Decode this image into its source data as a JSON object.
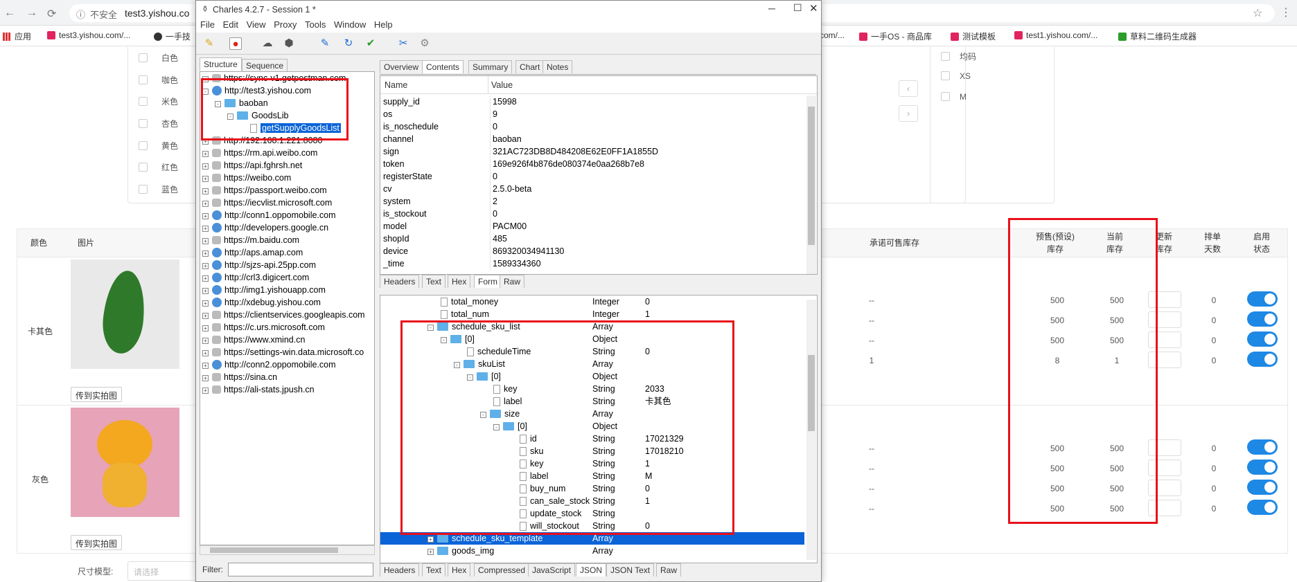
{
  "browser": {
    "insecure_label": "不安全",
    "url": "test3.yishou.co",
    "bookmarks_left": [
      {
        "label": "应用"
      },
      {
        "label": "test3.yishou.com/..."
      },
      {
        "label": "一手技"
      }
    ],
    "bookmarks_right": [
      {
        "label": "com/..."
      },
      {
        "label": "一手OS - 商品库"
      },
      {
        "label": "测试模板"
      },
      {
        "label": "test1.yishou.com/..."
      },
      {
        "label": "草料二维码生成器"
      }
    ]
  },
  "page": {
    "colors": [
      "白色",
      "咖色",
      "米色",
      "杏色",
      "黄色",
      "红色",
      "蓝色"
    ],
    "sizes": [
      "均码",
      "XS",
      "M"
    ],
    "table_headers": {
      "color": "颜色",
      "image": "图片",
      "promised": "承诺可售库存",
      "presale": "预售(预设)\n库存",
      "current": "当前\n库存",
      "update": "更新\n库存",
      "queue": "排单\n天数",
      "status": "启用\n状态"
    },
    "row_labels": [
      "卡其色",
      "灰色"
    ],
    "upload_btn": "传到实拍图",
    "size_model_label": "尺寸模型:",
    "size_model_placeholder": "请选择",
    "rows": [
      {
        "promised": "--",
        "presale": "500",
        "current": "500",
        "queue": "0"
      },
      {
        "promised": "--",
        "presale": "500",
        "current": "500",
        "queue": "0"
      },
      {
        "promised": "--",
        "presale": "500",
        "current": "500",
        "queue": "0"
      },
      {
        "promised": "1",
        "presale": "8",
        "current": "1",
        "queue": "0"
      },
      {
        "promised": "--",
        "presale": "500",
        "current": "500",
        "queue": "0"
      },
      {
        "promised": "--",
        "presale": "500",
        "current": "500",
        "queue": "0"
      },
      {
        "promised": "--",
        "presale": "500",
        "current": "500",
        "queue": "0"
      },
      {
        "promised": "--",
        "presale": "500",
        "current": "500",
        "queue": "0"
      }
    ]
  },
  "charles": {
    "title": "Charles 4.2.7 - Session 1 *",
    "menu": [
      "File",
      "Edit",
      "View",
      "Proxy",
      "Tools",
      "Window",
      "Help"
    ],
    "left_tabs": [
      "Structure",
      "Sequence"
    ],
    "top_tabs": [
      "Overview",
      "Contents",
      "Summary",
      "Chart",
      "Notes"
    ],
    "kv_headers": {
      "name": "Name",
      "value": "Value"
    },
    "kv": [
      {
        "k": "supply_id",
        "v": "15998"
      },
      {
        "k": "os",
        "v": "9"
      },
      {
        "k": "is_noschedule",
        "v": "0"
      },
      {
        "k": "channel",
        "v": "baoban"
      },
      {
        "k": "sign",
        "v": "321AC723DB8D484208E62E0FF1A1855D"
      },
      {
        "k": "token",
        "v": "169e926f4b876de080374e0aa268b7e8"
      },
      {
        "k": "registerState",
        "v": "0"
      },
      {
        "k": "cv",
        "v": "2.5.0-beta"
      },
      {
        "k": "system",
        "v": "2"
      },
      {
        "k": "is_stockout",
        "v": "0"
      },
      {
        "k": "model",
        "v": "PACM00"
      },
      {
        "k": "shopId",
        "v": "485"
      },
      {
        "k": "device",
        "v": "869320034941130"
      },
      {
        "k": "_time",
        "v": "1589334360"
      }
    ],
    "req_tabs": [
      "Headers",
      "Text",
      "Hex",
      "Form",
      "Raw"
    ],
    "resp_tabs": [
      "Headers",
      "Text",
      "Hex",
      "Compressed",
      "JavaScript",
      "JSON",
      "JSON Text",
      "Raw"
    ],
    "filter_label": "Filter:",
    "tree": [
      {
        "label": "https://sync-v1.getpostman.com",
        "icon": "lock",
        "indent": 0,
        "exp": "+"
      },
      {
        "label": "http://test3.yishou.com",
        "icon": "globe",
        "indent": 0,
        "exp": "-"
      },
      {
        "label": "baoban",
        "icon": "folder",
        "indent": 1,
        "exp": "-"
      },
      {
        "label": "GoodsLib",
        "icon": "folder",
        "indent": 2,
        "exp": "-"
      },
      {
        "label": "getSupplyGoodsList",
        "icon": "file",
        "indent": 3,
        "exp": "",
        "sel": true
      },
      {
        "label": "http://192.168.1.221:8080",
        "icon": "lock",
        "indent": 0,
        "exp": "+"
      },
      {
        "label": "https://rm.api.weibo.com",
        "icon": "lock",
        "indent": 0,
        "exp": "+"
      },
      {
        "label": "https://api.fghrsh.net",
        "icon": "lock",
        "indent": 0,
        "exp": "+"
      },
      {
        "label": "https://weibo.com",
        "icon": "lock",
        "indent": 0,
        "exp": "+"
      },
      {
        "label": "https://passport.weibo.com",
        "icon": "lock",
        "indent": 0,
        "exp": "+"
      },
      {
        "label": "https://iecvlist.microsoft.com",
        "icon": "lock",
        "indent": 0,
        "exp": "+"
      },
      {
        "label": "http://conn1.oppomobile.com",
        "icon": "globe",
        "indent": 0,
        "exp": "+"
      },
      {
        "label": "http://developers.google.cn",
        "icon": "globe",
        "indent": 0,
        "exp": "+"
      },
      {
        "label": "https://m.baidu.com",
        "icon": "lock",
        "indent": 0,
        "exp": "+"
      },
      {
        "label": "http://aps.amap.com",
        "icon": "globe",
        "indent": 0,
        "exp": "+"
      },
      {
        "label": "http://sjzs-api.25pp.com",
        "icon": "globe",
        "indent": 0,
        "exp": "+"
      },
      {
        "label": "http://crl3.digicert.com",
        "icon": "globe",
        "indent": 0,
        "exp": "+"
      },
      {
        "label": "http://img1.yishouapp.com",
        "icon": "globe",
        "indent": 0,
        "exp": "+"
      },
      {
        "label": "http://xdebug.yishou.com",
        "icon": "globe",
        "indent": 0,
        "exp": "+"
      },
      {
        "label": "https://clientservices.googleapis.com",
        "icon": "lock",
        "indent": 0,
        "exp": "+"
      },
      {
        "label": "https://c.urs.microsoft.com",
        "icon": "lock",
        "indent": 0,
        "exp": "+"
      },
      {
        "label": "https://www.xmind.cn",
        "icon": "lock",
        "indent": 0,
        "exp": "+"
      },
      {
        "label": "https://settings-win.data.microsoft.co",
        "icon": "lock",
        "indent": 0,
        "exp": "+"
      },
      {
        "label": "http://conn2.oppomobile.com",
        "icon": "globe",
        "indent": 0,
        "exp": "+"
      },
      {
        "label": "https://sina.cn",
        "icon": "lock",
        "indent": 0,
        "exp": "+"
      },
      {
        "label": "https://ali-stats.jpush.cn",
        "icon": "lock",
        "indent": 0,
        "exp": "+"
      }
    ],
    "json": [
      {
        "n": "total_money",
        "t": "Integer",
        "v": "0",
        "indent": 3,
        "icon": "file",
        "exp": ""
      },
      {
        "n": "total_num",
        "t": "Integer",
        "v": "1",
        "indent": 3,
        "icon": "file",
        "exp": ""
      },
      {
        "n": "schedule_sku_list",
        "t": "Array",
        "v": "",
        "indent": 2,
        "icon": "folder",
        "exp": "-"
      },
      {
        "n": "[0]",
        "t": "Object",
        "v": "",
        "indent": 3,
        "icon": "folder",
        "exp": "-"
      },
      {
        "n": "scheduleTime",
        "t": "String",
        "v": "0",
        "indent": 5,
        "icon": "file",
        "exp": ""
      },
      {
        "n": "skuList",
        "t": "Array",
        "v": "",
        "indent": 4,
        "icon": "folder",
        "exp": "-"
      },
      {
        "n": "[0]",
        "t": "Object",
        "v": "",
        "indent": 5,
        "icon": "folder",
        "exp": "-"
      },
      {
        "n": "key",
        "t": "String",
        "v": "2033",
        "indent": 7,
        "icon": "file",
        "exp": ""
      },
      {
        "n": "label",
        "t": "String",
        "v": "卡其色",
        "indent": 7,
        "icon": "file",
        "exp": ""
      },
      {
        "n": "size",
        "t": "Array",
        "v": "",
        "indent": 6,
        "icon": "folder",
        "exp": "-"
      },
      {
        "n": "[0]",
        "t": "Object",
        "v": "",
        "indent": 7,
        "icon": "folder",
        "exp": "-"
      },
      {
        "n": "id",
        "t": "String",
        "v": "17021329",
        "indent": 9,
        "icon": "file",
        "exp": ""
      },
      {
        "n": "sku",
        "t": "String",
        "v": "17018210",
        "indent": 9,
        "icon": "file",
        "exp": ""
      },
      {
        "n": "key",
        "t": "String",
        "v": "1",
        "indent": 9,
        "icon": "file",
        "exp": ""
      },
      {
        "n": "label",
        "t": "String",
        "v": "M",
        "indent": 9,
        "icon": "file",
        "exp": ""
      },
      {
        "n": "buy_num",
        "t": "String",
        "v": "0",
        "indent": 9,
        "icon": "file",
        "exp": ""
      },
      {
        "n": "can_sale_stock",
        "t": "String",
        "v": "1",
        "indent": 9,
        "icon": "file",
        "exp": ""
      },
      {
        "n": "update_stock",
        "t": "String",
        "v": "",
        "indent": 9,
        "icon": "file",
        "exp": ""
      },
      {
        "n": "will_stockout",
        "t": "String",
        "v": "0",
        "indent": 9,
        "icon": "file",
        "exp": ""
      },
      {
        "n": "schedule_sku_template",
        "t": "Array",
        "v": "",
        "indent": 2,
        "icon": "folder",
        "exp": "+",
        "sel": true
      },
      {
        "n": "goods_img",
        "t": "Array",
        "v": "",
        "indent": 2,
        "icon": "folder",
        "exp": "+"
      }
    ]
  }
}
